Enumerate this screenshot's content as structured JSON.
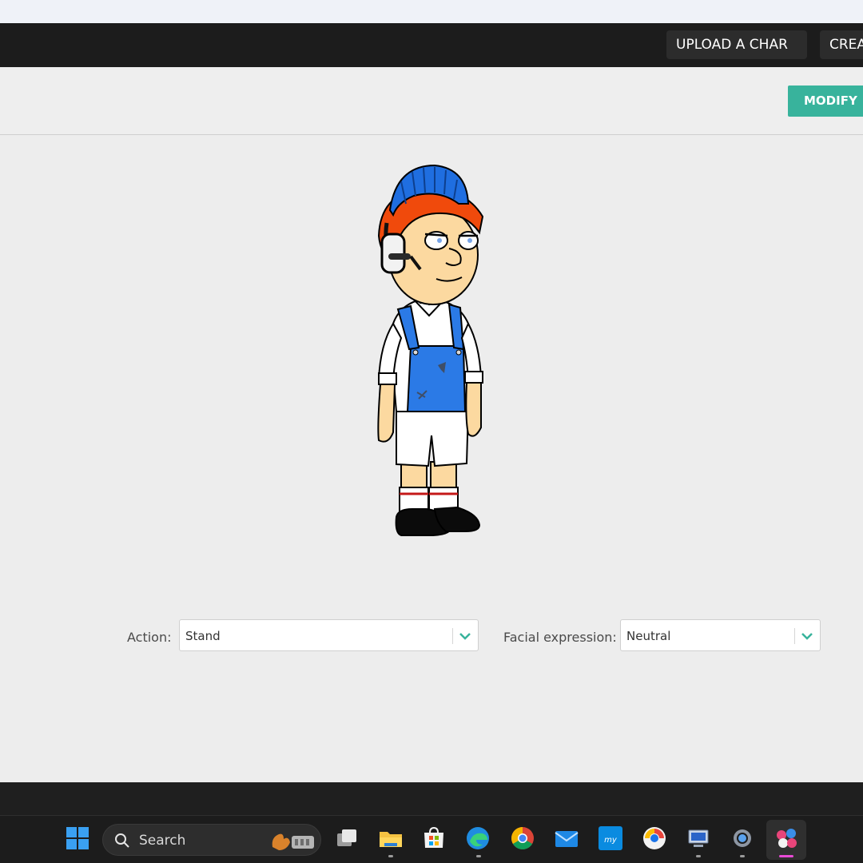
{
  "nav": {
    "upload_label": "UPLOAD A CHAR",
    "create_label": "CREA"
  },
  "toolbar": {
    "modify_label": "MODIFY"
  },
  "controls": {
    "action_label": "Action:",
    "action_value": "Stand",
    "facial_label": "Facial expression:",
    "facial_value": "Neutral"
  },
  "taskbar": {
    "search_placeholder": "Search",
    "icons": [
      "windows-start-icon",
      "task-view-icon",
      "file-explorer-icon",
      "microsoft-store-icon",
      "edge-icon",
      "chrome-icon",
      "mail-icon",
      "myhp-icon",
      "password-manager-icon",
      "remote-desktop-icon",
      "settings-icon",
      "character-app-icon"
    ]
  },
  "colors": {
    "accent": "#38b39c",
    "nav_bg": "#1c1c1c",
    "stage_bg": "#ededed"
  }
}
